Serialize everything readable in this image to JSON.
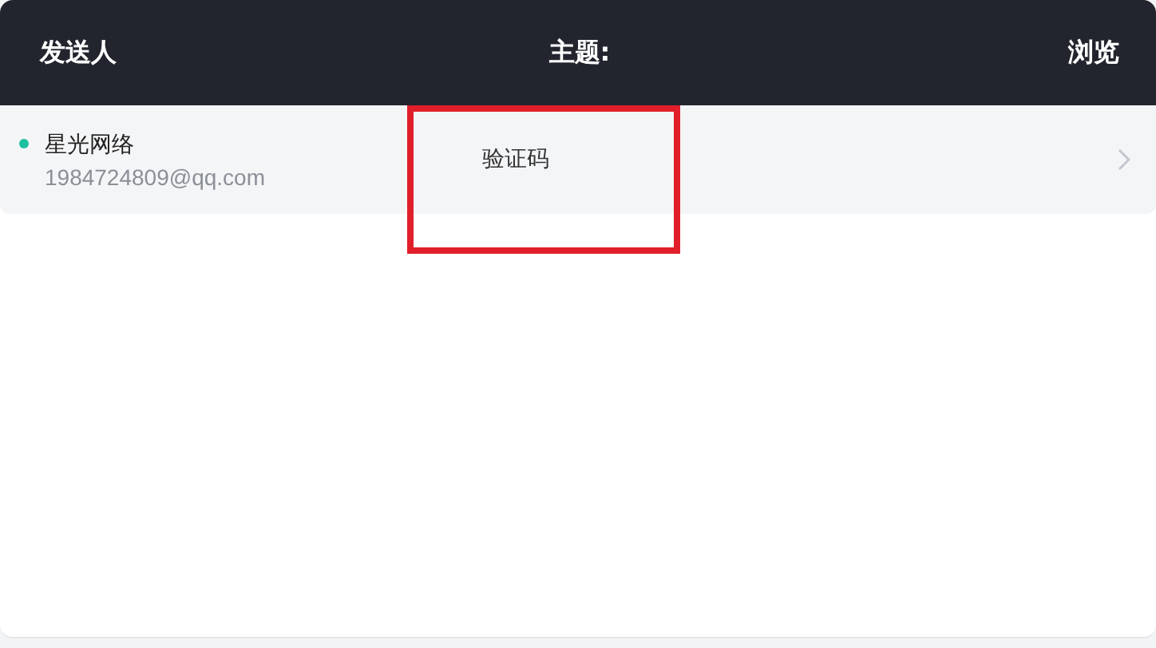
{
  "header": {
    "sender": "发送人",
    "subject": "主题:",
    "view": "浏览"
  },
  "messages": [
    {
      "sender_name": "星光网络",
      "sender_email": "1984724809@qq.com",
      "subject": "验证码",
      "unread": true,
      "highlighted": true
    }
  ]
}
